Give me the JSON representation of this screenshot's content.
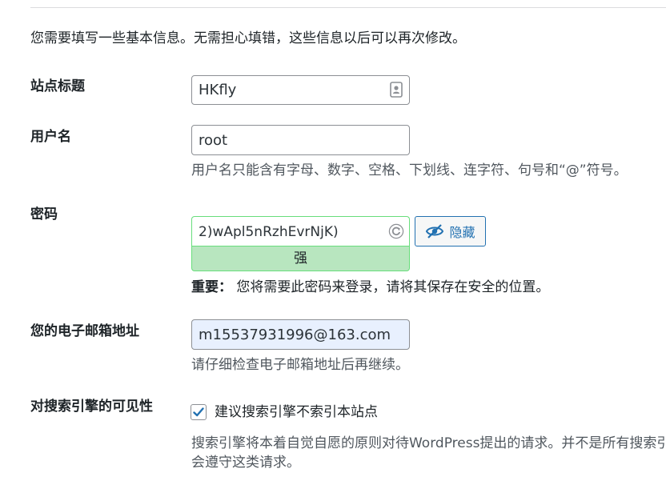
{
  "intro": "您需要填写一些基本信息。无需担心填错，这些信息以后可以再次修改。",
  "site_title": {
    "label": "站点标题",
    "value": "HKfly",
    "icon": "contact-card-icon"
  },
  "username": {
    "label": "用户名",
    "value": "root",
    "description": "用户名只能含有字母、数字、空格、下划线、连字符、句号和“@”符号。"
  },
  "password": {
    "label": "密码",
    "value": "2)wApl5nRzhEvrNjK)",
    "regenerate_icon": "refresh-icon",
    "strength": "强",
    "hide_button": "隐藏",
    "hide_icon": "eye-slash-icon",
    "important_label": "重要：",
    "important_text": "您将需要此密码来登录，请将其保存在安全的位置。",
    "strength_color": "#b8e6bf"
  },
  "email": {
    "label": "您的电子邮箱地址",
    "value": "m15537931996@163.com",
    "description": "请仔细检查电子邮箱地址后再继续。"
  },
  "search_visibility": {
    "label": "对搜索引擎的可见性",
    "checkbox_label": "建议搜索引擎不索引本站点",
    "checked": true,
    "description_line1": "搜索引擎将本着自觉自愿的原则对待WordPress提出的请求。并不是所有搜索引",
    "description_line2": "会遵守这类请求。"
  },
  "colors": {
    "accent": "#2271b1",
    "text": "#1d2327",
    "muted": "#50575e",
    "autofill_bg": "#e8f0fe"
  }
}
